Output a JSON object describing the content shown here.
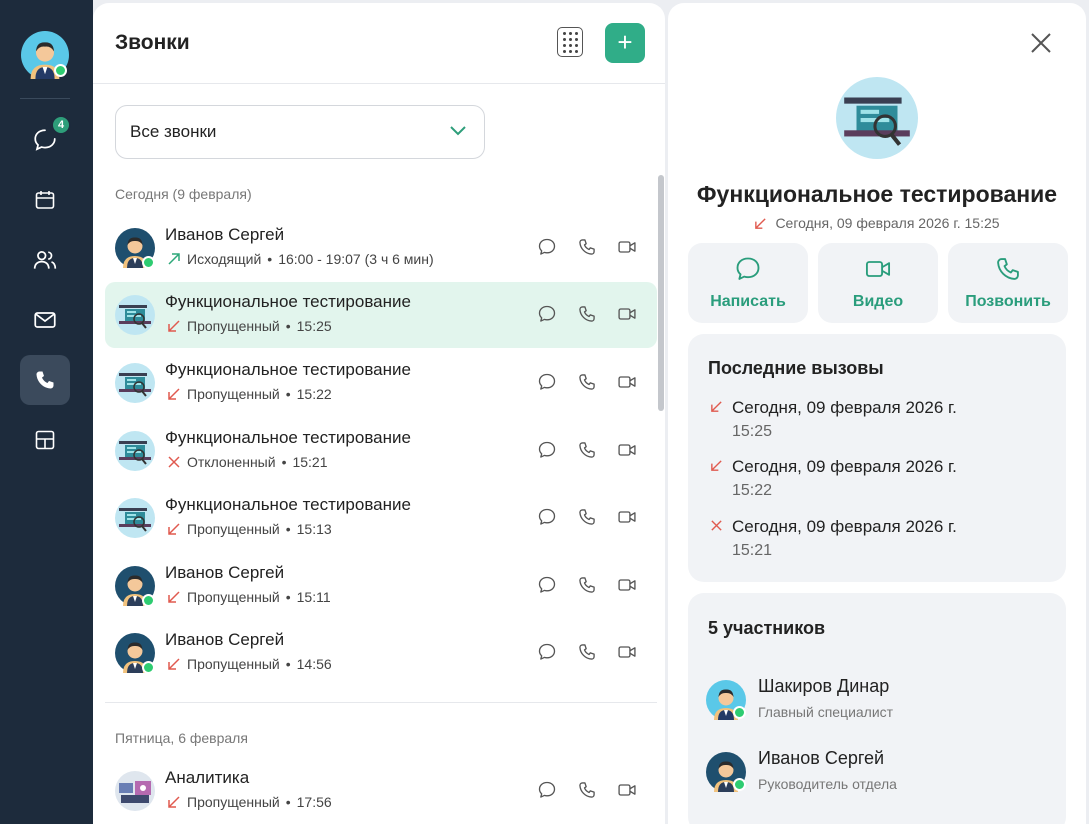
{
  "sidebar": {
    "chat_badge": "4",
    "items": [
      {
        "name": "chats-icon"
      },
      {
        "name": "calendar-icon"
      },
      {
        "name": "contacts-icon"
      },
      {
        "name": "mail-icon"
      },
      {
        "name": "phone-icon"
      },
      {
        "name": "apps-icon"
      }
    ]
  },
  "calls": {
    "title": "Звонки",
    "add_label": "+",
    "filter": {
      "selected": "Все звонки"
    },
    "groups": [
      {
        "label": "Сегодня (9 февраля)"
      },
      {
        "label": "Пятница, 6 февраля"
      }
    ],
    "rows": [
      {
        "name": "Иванов Сергей",
        "status": "Исходящий",
        "time": "16:00 - 19:07 (3 ч 6 мин)"
      },
      {
        "name": "Функциональное тестирование",
        "status": "Пропущенный",
        "time": "15:25"
      },
      {
        "name": "Функциональное тестирование",
        "status": "Пропущенный",
        "time": "15:22"
      },
      {
        "name": "Функциональное тестирование",
        "status": "Отклоненный",
        "time": "15:21"
      },
      {
        "name": "Функциональное тестирование",
        "status": "Пропущенный",
        "time": "15:13"
      },
      {
        "name": "Иванов Сергей",
        "status": "Пропущенный",
        "time": "15:11"
      },
      {
        "name": "Иванов Сергей",
        "status": "Пропущенный",
        "time": "14:56"
      },
      {
        "name": "Аналитика",
        "status": "Пропущенный",
        "time": "17:56"
      }
    ],
    "separator": "•"
  },
  "detail": {
    "title": "Функциональное тестирование",
    "subtitle": "Сегодня, 09 февраля 2026 г. 15:25",
    "actions": {
      "write": "Написать",
      "video": "Видео",
      "call": "Позвонить"
    },
    "recent": {
      "title": "Последние вызовы",
      "items": [
        {
          "date": "Сегодня, 09 февраля 2026 г.",
          "time": "15:25"
        },
        {
          "date": "Сегодня, 09 февраля 2026 г.",
          "time": "15:22"
        },
        {
          "date": "Сегодня, 09 февраля 2026 г.",
          "time": "15:21"
        }
      ]
    },
    "members": {
      "title": "5 участников",
      "items": [
        {
          "name": "Шакиров Динар",
          "role": "Главный специалист"
        },
        {
          "name": "Иванов Сергей",
          "role": "Руководитель отдела"
        }
      ]
    }
  },
  "colors": {
    "accent": "#30ad88",
    "missed": "#e05a4f",
    "outgoing": "#2ea87a",
    "sidebar": "#1d2b3c",
    "selected_row": "#e2f5ed",
    "online": "#2ecc71"
  }
}
